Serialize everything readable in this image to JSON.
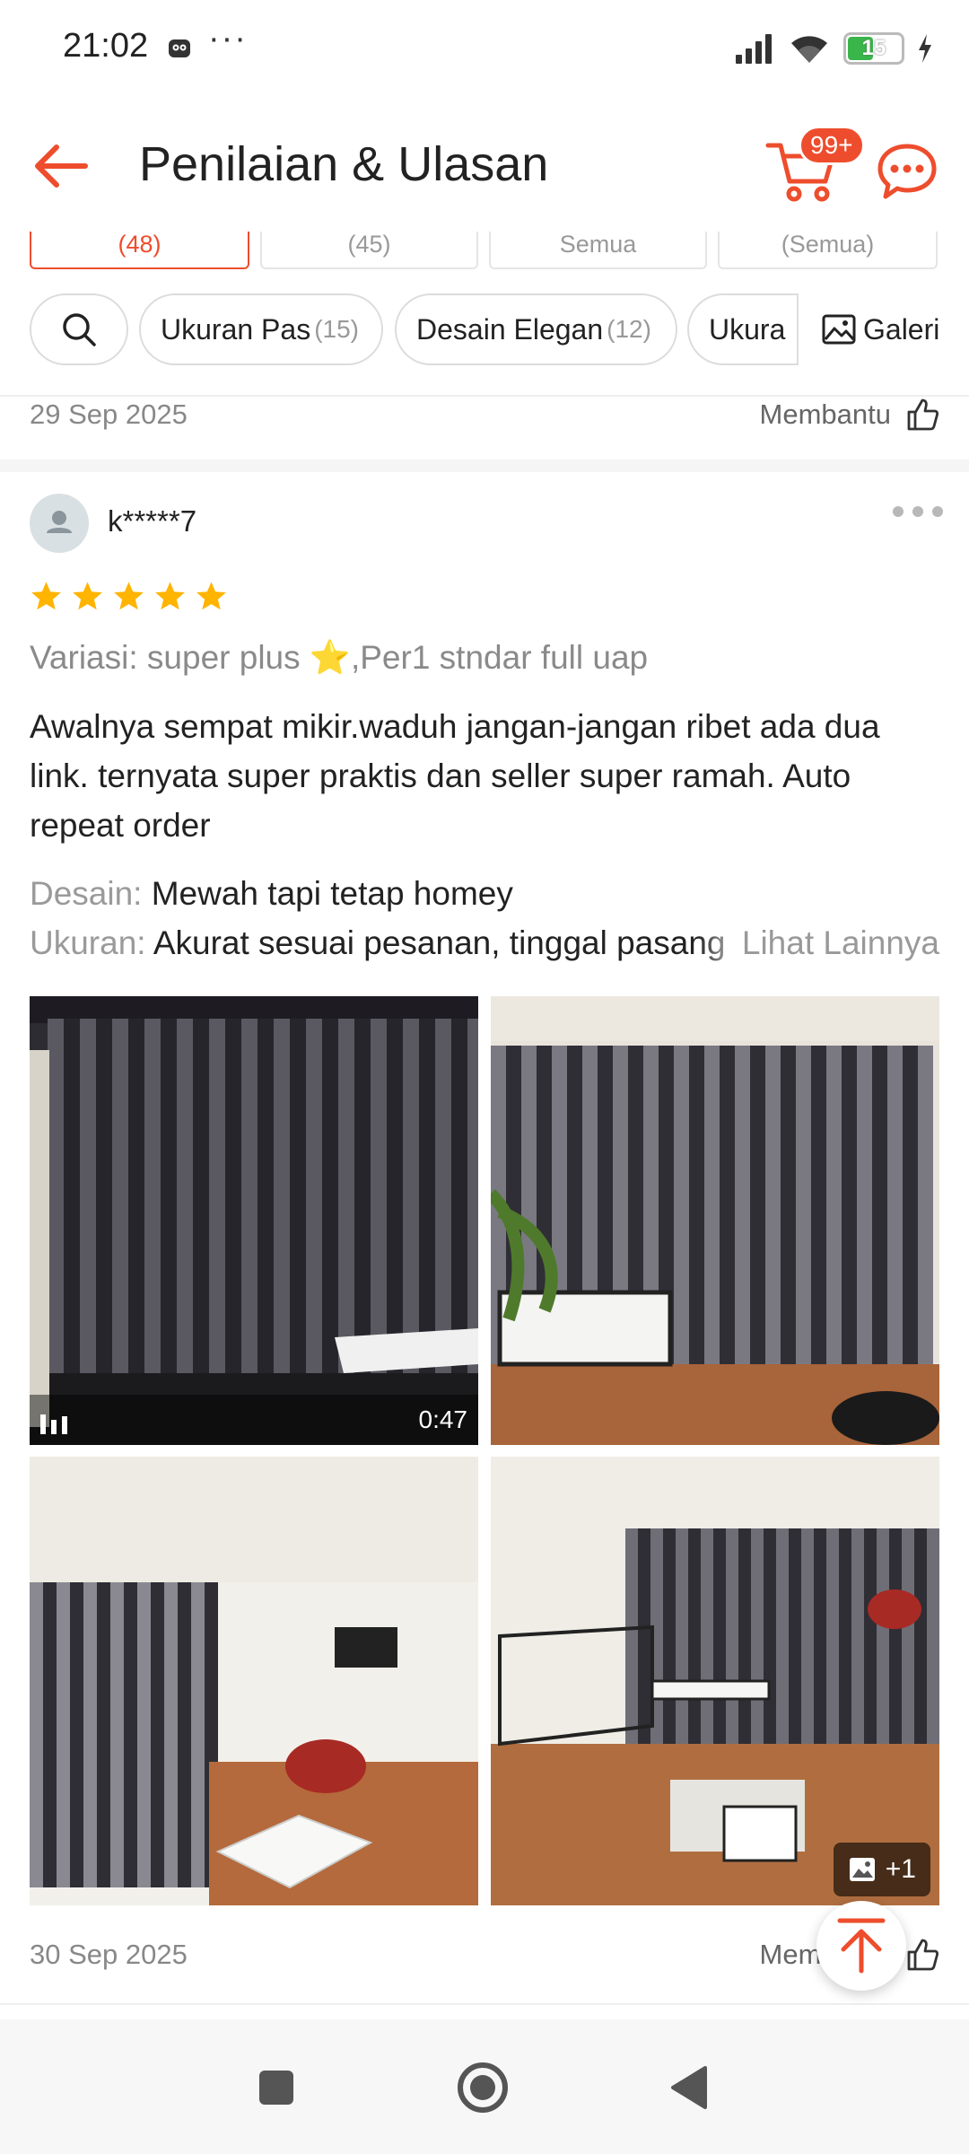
{
  "status_bar": {
    "time": "21:02",
    "dots": "···",
    "battery_level": "15",
    "icons": [
      "notification-icon",
      "signal-icon",
      "wifi-icon",
      "battery-icon",
      "charging-icon"
    ]
  },
  "header": {
    "title": "Penilaian & Ulasan",
    "cart_badge": "99+",
    "icons": [
      "back-arrow-icon",
      "cart-icon",
      "chat-icon"
    ]
  },
  "rating_tabs": [
    {
      "label": "(48)",
      "active": true
    },
    {
      "label": "(45)",
      "active": false
    },
    {
      "label": "Semua",
      "active": false
    },
    {
      "label": "(Semua)",
      "active": false
    }
  ],
  "filter_chips": [
    {
      "label": "Ukuran Pas",
      "count": "(15)"
    },
    {
      "label": "Desain Elegan",
      "count": "(12)"
    },
    {
      "label": "Ukura",
      "count": ""
    }
  ],
  "gallery_label": "Galeri",
  "previous_review_footer": {
    "date": "29 Sep 2025",
    "helpful_label": "Membantu"
  },
  "review": {
    "username": "k*****7",
    "rating": 5,
    "variation": "Variasi: super plus ⭐️,Per1 stndar full uap",
    "text": "Awalnya sempat mikir.waduh jangan-jangan ribet ada dua link. ternyata super praktis dan seller super ramah. Auto repeat order",
    "attributes": [
      {
        "label": "Desain:",
        "value": "Mewah tapi tetap homey"
      },
      {
        "label": "Ukuran:",
        "value": "Akurat sesuai pesanan, tinggal pasang"
      }
    ],
    "see_more_label": "Lihat Lainnya",
    "video_duration": "0:47",
    "more_photos_label": "+1",
    "date": "30 Sep 2025",
    "helpful_label": "Membantu"
  },
  "colors": {
    "accent": "#ee4d2d",
    "star": "#ffb400",
    "muted_text": "#8a8a8a"
  }
}
